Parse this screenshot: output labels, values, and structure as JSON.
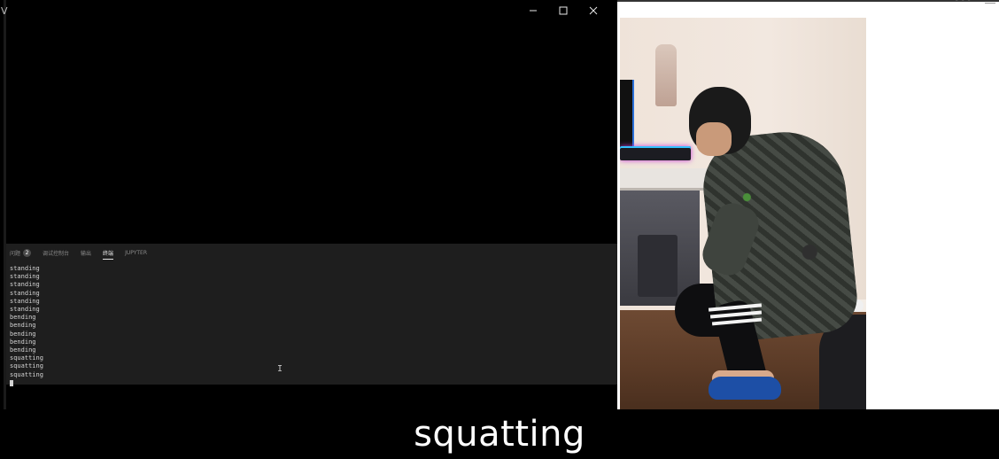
{
  "left_window": {
    "app_letter": "V",
    "controls": {
      "minimize": "minimize-icon",
      "maximize": "maximize-icon",
      "close": "close-icon"
    },
    "panel": {
      "tabs": [
        {
          "label": "问题",
          "badge": "2"
        },
        {
          "label": "调试控制台"
        },
        {
          "label": "输出"
        },
        {
          "label": "终端",
          "active": true
        },
        {
          "label": "JUPYTER"
        }
      ],
      "terminal_lines": [
        "standing",
        "standing",
        "standing",
        "standing",
        "standing",
        "standing",
        "bending",
        "bending",
        "bending",
        "bending",
        "bending",
        "squatting",
        "squatting",
        "squatting"
      ]
    }
  },
  "right_window": {
    "menu_icon": "more-icon"
  },
  "subtitle": "squatting"
}
